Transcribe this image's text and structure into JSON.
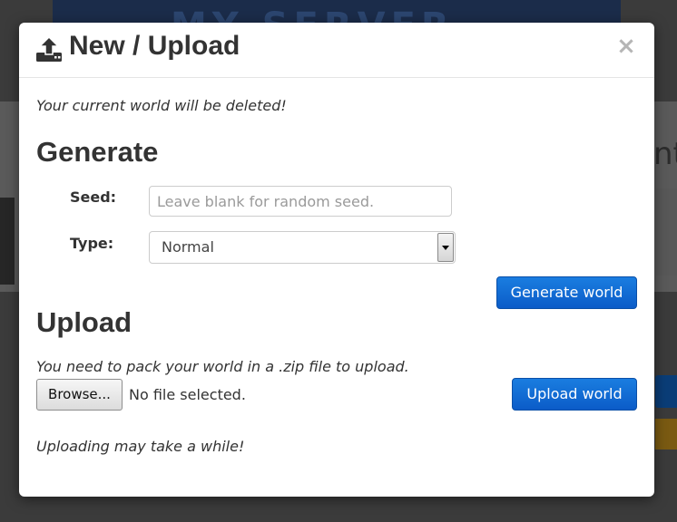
{
  "background": {
    "banner_text": "MY SERVER",
    "fragment_text": "nt"
  },
  "modal": {
    "title": "New / Upload",
    "title_icon": "upload-icon",
    "close_symbol": "×",
    "warning": "Your current world will be deleted!",
    "generate": {
      "heading": "Generate",
      "seed_label": "Seed:",
      "seed_placeholder": "Leave blank for random seed.",
      "seed_value": "",
      "type_label": "Type:",
      "type_selected": "Normal",
      "button_label": "Generate world"
    },
    "upload": {
      "heading": "Upload",
      "instructions": "You need to pack your world in a .zip file to upload.",
      "browse_label": "Browse...",
      "file_status": "No file selected.",
      "button_label": "Upload world",
      "note": "Uploading may take a while!"
    }
  },
  "colors": {
    "primary_button": "#0b5cc8",
    "text": "#333333",
    "overlay": "#3b3b3b"
  }
}
